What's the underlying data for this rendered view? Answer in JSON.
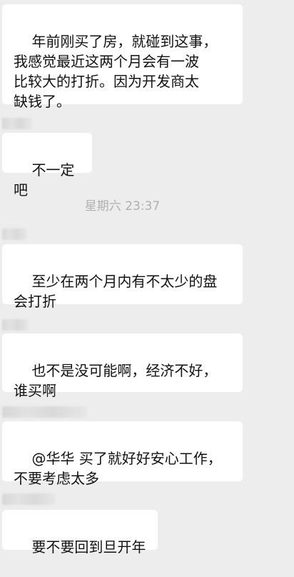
{
  "chat": {
    "messages": [
      {
        "text": "年前刚买了房，就碰到这事，\n我感觉最近这两个月会有一波\n比较大的打折。因为开发商太\n缺钱了。"
      },
      {
        "text": "不一定吧"
      },
      {
        "text": "至少在两个月内有不太少的盘\n会打折"
      },
      {
        "text": "也不是没可能啊，经济不好，\n谁买啊"
      },
      {
        "text": "@华华 买了就好好安心工作，\n不要考虑太多"
      },
      {
        "text": "要不要回到旦开年"
      }
    ],
    "timestamp": "星期六 23:37"
  },
  "colors": {
    "background": "#ededed",
    "bubble": "#ffffff",
    "timestamp_text": "#b0b0b0"
  }
}
